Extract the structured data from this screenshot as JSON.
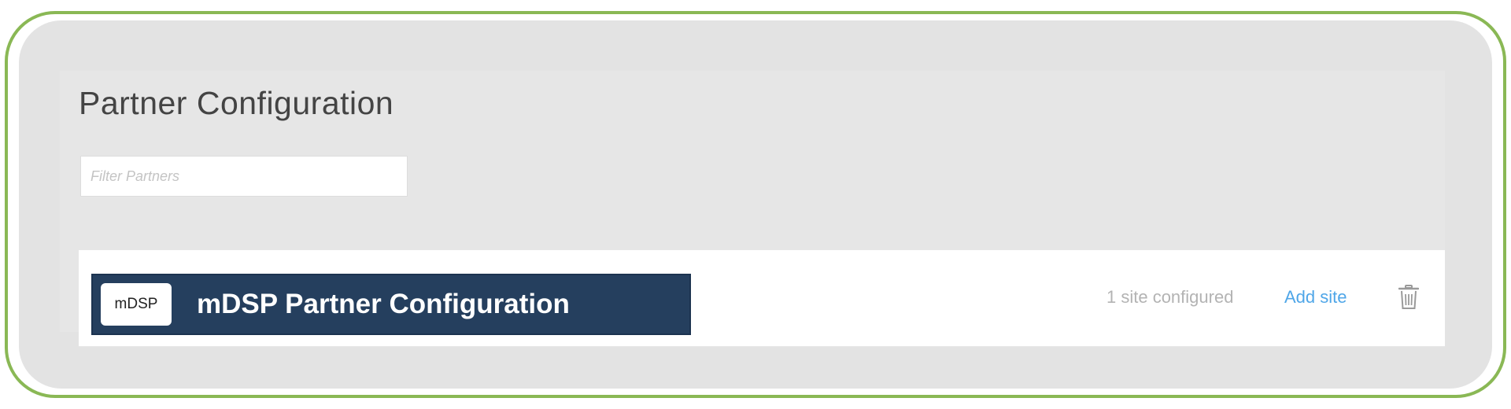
{
  "page": {
    "title": "Partner Configuration"
  },
  "filter": {
    "placeholder": "Filter Partners",
    "value": ""
  },
  "partners": [
    {
      "logo_text": "mDSP",
      "name": "mDSP Partner Configuration",
      "site_count": "1 site configured",
      "add_site_label": "Add site",
      "delete_icon": "trash-icon"
    }
  ],
  "colors": {
    "frame_border": "#8ab855",
    "banner_bg": "#253f5e",
    "link": "#4fa6e8"
  }
}
